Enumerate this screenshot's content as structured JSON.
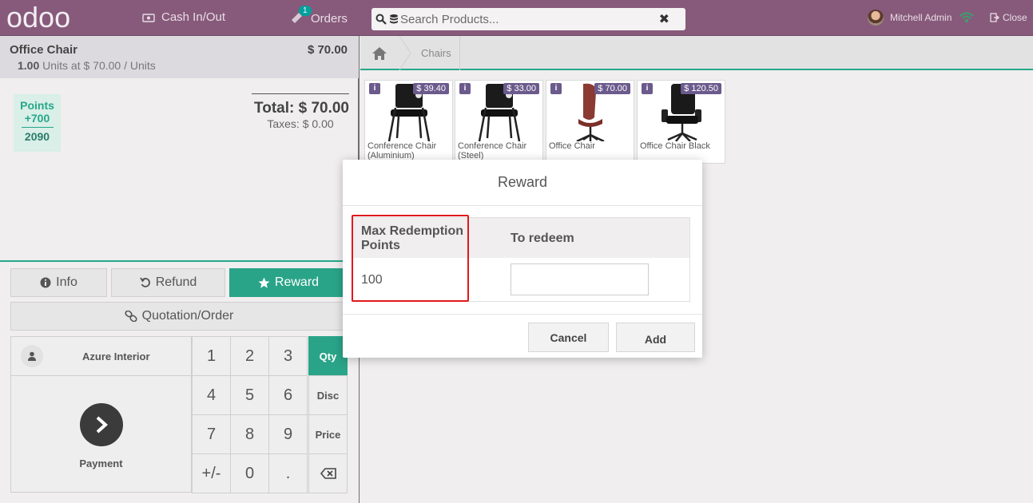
{
  "topbar": {
    "logo": "odoo",
    "cash_label": "Cash In/Out",
    "orders_label": "Orders",
    "orders_badge": "1",
    "search_placeholder": "Search Products...",
    "user_name": "Mitchell Admin",
    "close_label": "Close",
    "bar_color": "#875a7b"
  },
  "order": {
    "line_name": "Office Chair",
    "line_price": "$ 70.00",
    "line_qty": "1.00",
    "line_unit": "Units at $ 70.00 / Units",
    "points_label": "Points",
    "points_added": "+700",
    "points_total": "2090",
    "total": "Total: $ 70.00",
    "taxes": "Taxes: $ 0.00"
  },
  "controls": {
    "info": "Info",
    "refund": "Refund",
    "reward": "Reward",
    "quotation": "Quotation/Order",
    "customer": "Azure Interior",
    "payment": "Payment",
    "keys": [
      "1",
      "2",
      "3",
      "4",
      "5",
      "6",
      "7",
      "8",
      "9",
      "+/-",
      "0",
      "."
    ],
    "modes": [
      "Qty",
      "Disc",
      "Price"
    ],
    "accent": "#2aa488"
  },
  "catalog": {
    "breadcrumb": "Chairs",
    "products": [
      {
        "name": "Conference Chair (Aluminium)",
        "price": "$ 39.40"
      },
      {
        "name": "Conference Chair (Steel)",
        "price": "$ 33.00"
      },
      {
        "name": "Office Chair",
        "price": "$ 70.00"
      },
      {
        "name": "Office Chair Black",
        "price": "$ 120.50"
      }
    ]
  },
  "modal": {
    "title": "Reward",
    "col1": "Max Redemption Points",
    "col2": "To redeem",
    "max_points": "100",
    "to_redeem_value": "",
    "cancel": "Cancel",
    "add": "Add"
  }
}
